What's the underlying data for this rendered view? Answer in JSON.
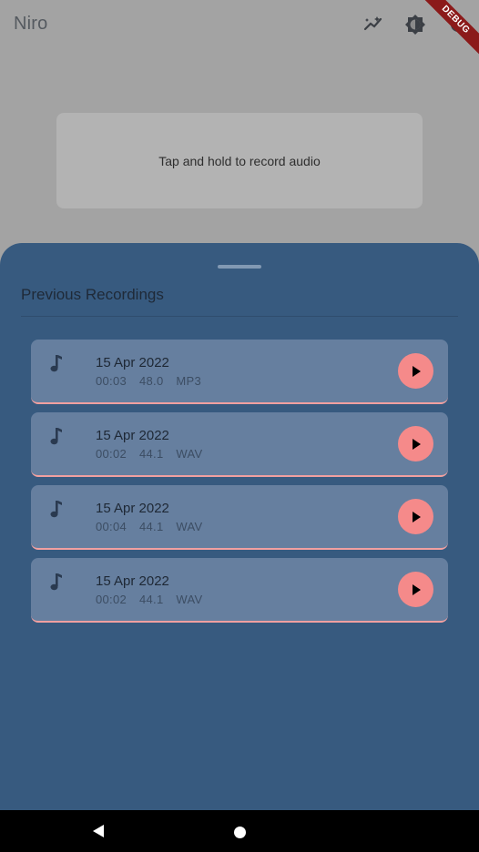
{
  "app": {
    "title": "Niro",
    "debug_banner": "DEBUG",
    "icons": [
      "magic-wand-icon",
      "theme-icon",
      "settings-icon"
    ]
  },
  "recorder": {
    "hint": "Tap and hold to record audio"
  },
  "sheet": {
    "title": "Previous Recordings",
    "recordings": [
      {
        "date": "15 Apr 2022",
        "duration": "00:03",
        "sample_rate": "48.0",
        "format": "MP3"
      },
      {
        "date": "15 Apr 2022",
        "duration": "00:02",
        "sample_rate": "44.1",
        "format": "WAV"
      },
      {
        "date": "15 Apr 2022",
        "duration": "00:04",
        "sample_rate": "44.1",
        "format": "WAV"
      },
      {
        "date": "15 Apr 2022",
        "duration": "00:02",
        "sample_rate": "44.1",
        "format": "WAV"
      }
    ]
  },
  "colors": {
    "sheet_bg": "#375a7f",
    "card_bg": "#667f9f",
    "accent": "#f58a8a"
  }
}
